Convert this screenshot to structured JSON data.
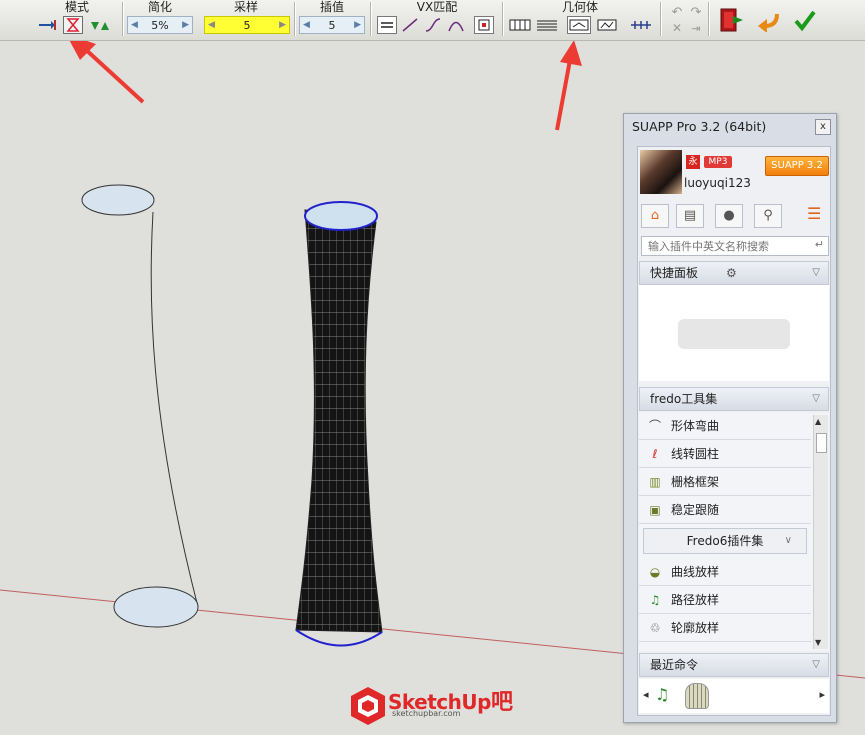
{
  "toolbar": {
    "groups": {
      "mode": "模式",
      "simplify": "简化",
      "sampling": "采样",
      "interp": "插值",
      "vx_match": "VX匹配",
      "geometry": "几何体"
    },
    "simplify_value": "5%",
    "sampling_value": "5",
    "interp_value": "5",
    "colors": {
      "accept": "#1a9b1a",
      "undo": "#e88a12",
      "exit": "#b01818",
      "highlight": "#ffff33"
    }
  },
  "panel": {
    "title": "SUAPP Pro 3.2 (64bit)",
    "close": "x",
    "badge_vip": "永",
    "badge_mp": "MP3",
    "version_button": "SUAPP 3.2",
    "username": "luoyuqi123",
    "search_placeholder": "输入插件中英文名称搜索",
    "quick_panel": {
      "title": "快捷面板"
    },
    "fredo_section": {
      "title": "fredo工具集",
      "items": [
        {
          "label": "形体弯曲",
          "icon": "bend-icon"
        },
        {
          "label": "线转圆柱",
          "icon": "tube-icon"
        },
        {
          "label": "栅格框架",
          "icon": "lattice-icon"
        },
        {
          "label": "稳定跟随",
          "icon": "follow-icon"
        }
      ],
      "sub_dropdown": "Fredo6插件集",
      "sub_items": [
        {
          "label": "曲线放样",
          "icon": "loft-icon"
        },
        {
          "label": "路径放样",
          "icon": "path-loft-icon"
        },
        {
          "label": "轮廓放样",
          "icon": "skin-icon"
        }
      ]
    },
    "recent": {
      "title": "最近命令"
    }
  },
  "watermark": {
    "brand": "SketchUp",
    "suffix": "吧",
    "url": "sketchupbar.com"
  }
}
